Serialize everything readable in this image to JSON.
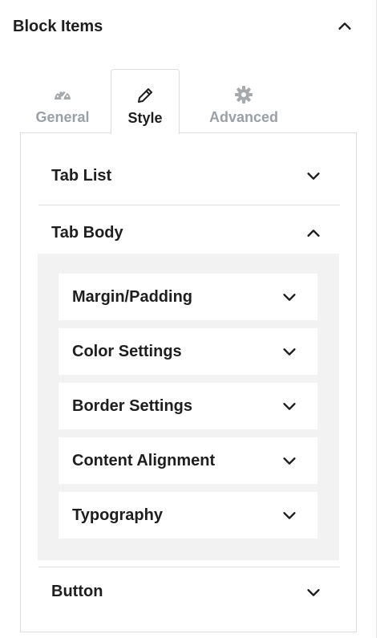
{
  "panel": {
    "title": "Block Items"
  },
  "tabs": [
    {
      "label": "General",
      "icon": "dashboard-gauge-icon"
    },
    {
      "label": "Style",
      "icon": "pencil-icon"
    },
    {
      "label": "Advanced",
      "icon": "gear-icon"
    }
  ],
  "sections": {
    "tab_list": "Tab List",
    "tab_body": "Tab Body",
    "button": "Button"
  },
  "tab_body_items": [
    "Margin/Padding",
    "Color Settings",
    "Border Settings",
    "Content Alignment",
    "Typography"
  ],
  "colors": {
    "text": "#1e1e1e",
    "muted": "#9aa0a6",
    "border": "#dcdde0",
    "subpanel_bg": "#f2f2f3"
  }
}
